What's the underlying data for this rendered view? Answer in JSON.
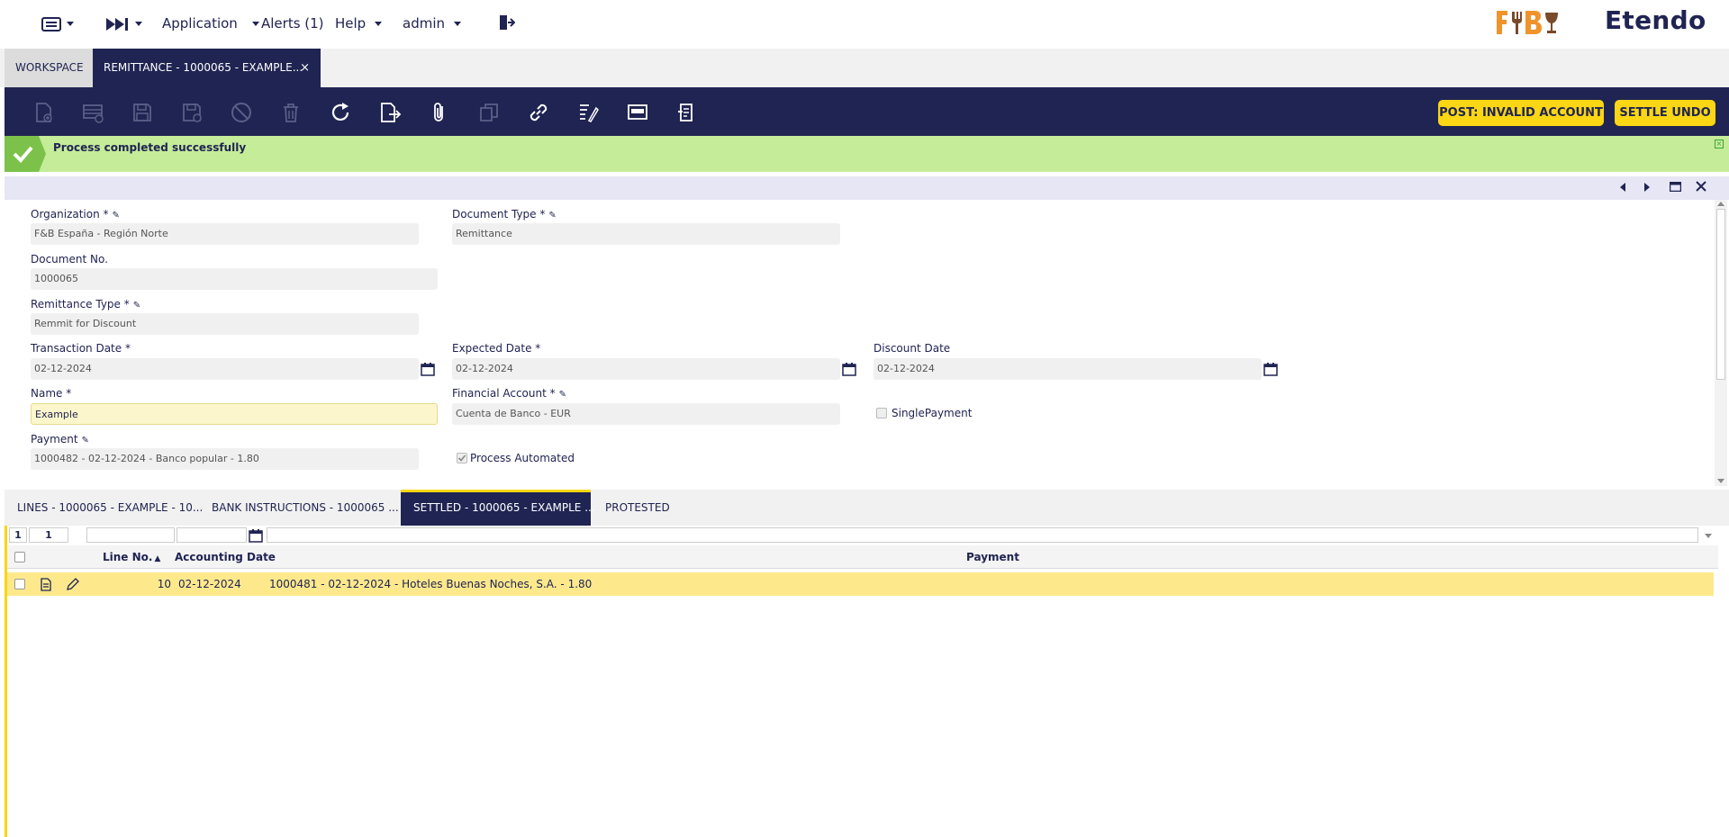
{
  "nav": {
    "application": "Application",
    "alerts": "Alerts (1)",
    "help": "Help",
    "user": "admin",
    "brand": "Etendo"
  },
  "window_tabs": {
    "workspace": "WORKSPACE",
    "current": "REMITTANCE - 1000065 - EXAMPLE...",
    "close": "×"
  },
  "toolbar": {
    "post_button": "POST: INVALID ACCOUNT",
    "settle_undo_button": "SETTLE UNDO"
  },
  "message": {
    "text": "Process completed successfully"
  },
  "form": {
    "organization": {
      "label": "Organization *",
      "value": "F&B España - Región Norte"
    },
    "document_type": {
      "label": "Document Type *",
      "value": "Remittance"
    },
    "document_no": {
      "label": "Document No.",
      "value": "1000065"
    },
    "remittance_type": {
      "label": "Remittance Type *",
      "value": "Remmit for Discount"
    },
    "transaction_date": {
      "label": "Transaction Date *",
      "value": "02-12-2024"
    },
    "expected_date": {
      "label": "Expected Date *",
      "value": "02-12-2024"
    },
    "discount_date": {
      "label": "Discount Date",
      "value": "02-12-2024"
    },
    "name": {
      "label": "Name *",
      "value": "Example"
    },
    "financial_account": {
      "label": "Financial Account *",
      "value": "Cuenta de Banco - EUR"
    },
    "single_payment": {
      "label": "SinglePayment",
      "checked": false
    },
    "payment": {
      "label": "Payment",
      "value": "1000482 - 02-12-2024 - Banco popular - 1.80"
    },
    "process_automated": {
      "label": "Process Automated",
      "checked": true
    }
  },
  "subtabs": [
    {
      "label": "LINES - 1000065 - EXAMPLE - 10..."
    },
    {
      "label": "BANK INSTRUCTIONS - 1000065 ..."
    },
    {
      "label": "SETTLED - 1000065 - EXAMPLE ..."
    },
    {
      "label": "PROTESTED"
    }
  ],
  "grid": {
    "filter_count_a": "1",
    "filter_count_b": "1",
    "columns": {
      "line_no": "Line No.",
      "accounting_date": "Accounting Date",
      "payment": "Payment"
    },
    "rows": [
      {
        "line_no": "10",
        "accounting_date": "02-12-2024",
        "payment": "1000481 - 02-12-2024 - Hoteles Buenas Noches, S.A. - 1.80"
      }
    ]
  },
  "colors": {
    "navy": "#202452",
    "accent": "#fad614",
    "success": "#c5ec99",
    "fb_orange": "#f0932b"
  }
}
